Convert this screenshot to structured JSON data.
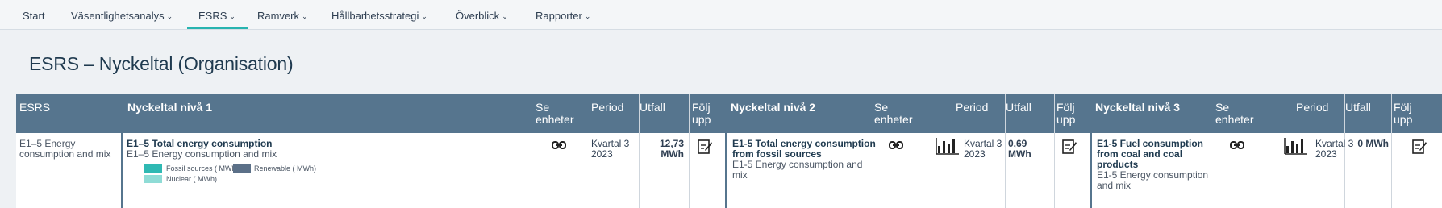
{
  "nav": {
    "items": [
      {
        "label": "Start",
        "has_chevron": false
      },
      {
        "label": "Väsentlighetsanalys",
        "has_chevron": true
      },
      {
        "label": "ESRS",
        "has_chevron": true,
        "active": true
      },
      {
        "label": "Ramverk",
        "has_chevron": true
      },
      {
        "label": "Hållbarhetsstrategi",
        "has_chevron": true
      },
      {
        "label": "Överblick",
        "has_chevron": true
      },
      {
        "label": "Rapporter",
        "has_chevron": true
      }
    ]
  },
  "page": {
    "title": "ESRS – Nyckeltal (Organisation)"
  },
  "table": {
    "headers": {
      "esrs": "ESRS",
      "level1": "Nyckeltal nivå 1",
      "level2": "Nyckeltal nivå 2",
      "level3": "Nyckeltal nivå 3",
      "se_enheter_1": "Se",
      "se_enheter_2": "enheter",
      "period": "Period",
      "utfall": "Utfall",
      "folj_1": "Följ",
      "folj_2": "upp"
    },
    "row": {
      "esrs_1": "E1–5 Energy",
      "esrs_2": "consumption and mix",
      "l1_title": "E1–5 Total energy consumption",
      "l1_sub": "E1–5 Energy consumption and mix",
      "l1_period_1": "Kvartal 3",
      "l1_period_2": "2023",
      "l1_value_1": "12,73",
      "l1_value_2": "MWh",
      "l2_title_1": "E1-5 Total energy consumption",
      "l2_title_2": "from fossil sources",
      "l2_sub_1": "E1-5 Energy consumption and",
      "l2_sub_2": "mix",
      "l2_period_1": "Kvartal 3",
      "l2_period_2": "2023",
      "l2_value": "0,69 MWh",
      "l3_title_1": "E1-5 Fuel consumption",
      "l3_title_2": "from coal and coal",
      "l3_title_3": "products",
      "l3_sub_1": "E1-5 Energy consumption",
      "l3_sub_2": "and mix",
      "l3_period_1": "Kvartal 3",
      "l3_period_2": "2023",
      "l3_value": "0 MWh"
    },
    "legend": {
      "fossil": "Fossil sources ( MWh)",
      "renewable": "Renewable ( MWh)",
      "nuclear": "Nuclear ( MWh)"
    }
  },
  "colors": {
    "accent": "#27b4b0",
    "header_bg": "#56758e",
    "fossil": "#2fb9b3",
    "renewable": "#5b7088",
    "nuclear": "#8fdcd6"
  },
  "icons": {
    "link": "link-icon",
    "chart": "bar-chart-icon",
    "followup": "edit-note-icon"
  }
}
